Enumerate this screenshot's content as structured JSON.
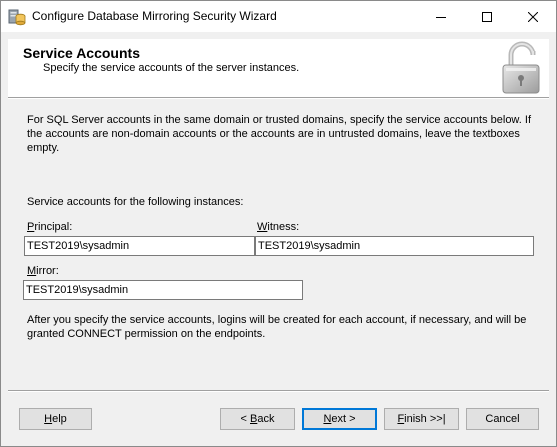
{
  "window": {
    "title": "Configure Database Mirroring Security Wizard",
    "app_icon": "database-server-icon",
    "controls": [
      "minimize-icon",
      "maximize-icon",
      "close-icon"
    ]
  },
  "header": {
    "title": "Service Accounts",
    "subtitle": "Specify the service accounts of the server instances.",
    "icon": "padlock-icon"
  },
  "body": {
    "info_text": "For SQL Server accounts in the same domain or trusted domains, specify the service accounts below. If the accounts are non-domain accounts or the accounts are in untrusted domains, leave the textboxes empty.",
    "instances_label": "Service accounts for the following instances:",
    "principal": {
      "label_key": "P",
      "label_rest": "rincipal:",
      "value": "TEST2019\\sysadmin"
    },
    "witness": {
      "label_key": "W",
      "label_rest": "itness:",
      "value": "TEST2019\\sysadmin"
    },
    "mirror": {
      "label_key": "M",
      "label_rest": "irror:",
      "value": "TEST2019\\sysadmin"
    },
    "after_text": "After you specify the service accounts, logins will be created for each account, if necessary, and will be granted CONNECT permission on the endpoints."
  },
  "buttons": {
    "help": {
      "key": "H",
      "rest": "elp"
    },
    "back": {
      "prefix": "< ",
      "key": "B",
      "rest": "ack"
    },
    "next": {
      "key": "N",
      "rest": "ext >"
    },
    "finish": {
      "key": "F",
      "rest": "inish >>|"
    },
    "cancel": {
      "label": "Cancel"
    }
  }
}
